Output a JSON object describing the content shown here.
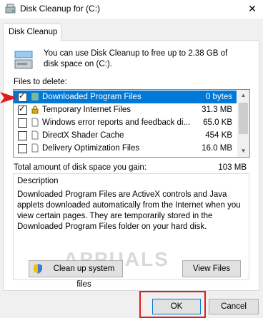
{
  "window": {
    "title": "Disk Cleanup for  (C:)",
    "close_symbol": "✕"
  },
  "tab": {
    "label": "Disk Cleanup"
  },
  "intro_text": "You can use Disk Cleanup to free up to 2.38 GB of disk space on  (C:).",
  "files_to_delete_label": "Files to delete:",
  "files": [
    {
      "name": "Downloaded Program Files",
      "size": "0 bytes",
      "checked": true,
      "selected": true
    },
    {
      "name": "Temporary Internet Files",
      "size": "31.3 MB",
      "checked": true,
      "selected": false
    },
    {
      "name": "Windows error reports and feedback di...",
      "size": "65.0 KB",
      "checked": false,
      "selected": false
    },
    {
      "name": "DirectX Shader Cache",
      "size": "454 KB",
      "checked": false,
      "selected": false
    },
    {
      "name": "Delivery Optimization Files",
      "size": "16.0 MB",
      "checked": false,
      "selected": false
    }
  ],
  "total": {
    "label": "Total amount of disk space you gain:",
    "value": "103 MB"
  },
  "description": {
    "title": "Description",
    "text": "Downloaded Program Files are ActiveX controls and Java applets downloaded automatically from the Internet when you view certain pages. They are temporarily stored in the Downloaded Program Files folder on your hard disk."
  },
  "watermark": "APPUALS",
  "buttons": {
    "cleanup_system_files": "Clean up system files",
    "view_files": "View Files",
    "ok": "OK",
    "cancel": "Cancel"
  },
  "colors": {
    "selection": "#0078d7",
    "highlight_red": "#e01c1c"
  }
}
